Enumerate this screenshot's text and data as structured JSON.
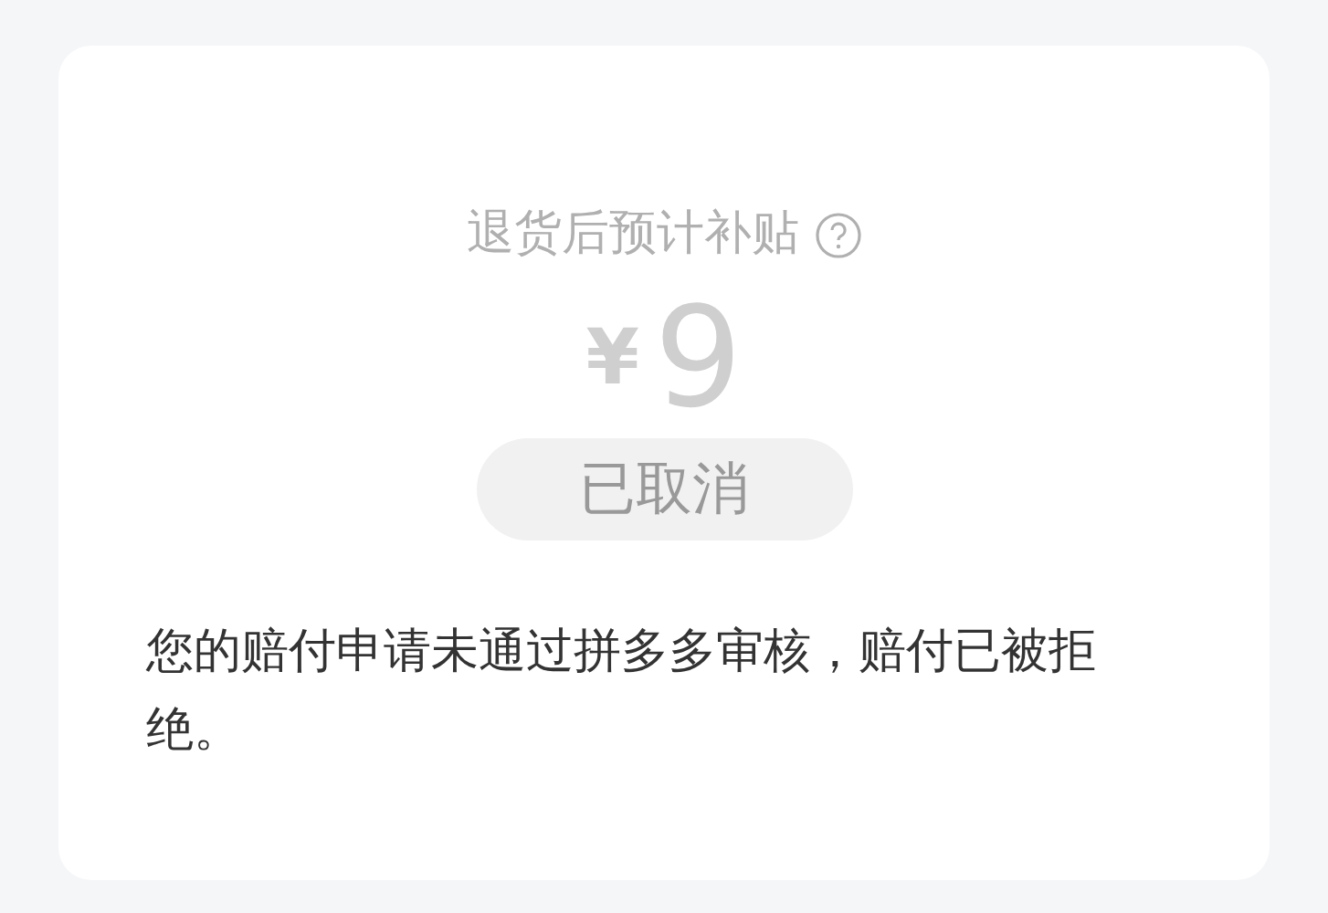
{
  "card": {
    "title": "退货后预计补贴",
    "currency": "¥",
    "amount": "9",
    "status": "已取消",
    "message": "您的赔付申请未通过拼多多审核，赔付已被拒绝。"
  }
}
